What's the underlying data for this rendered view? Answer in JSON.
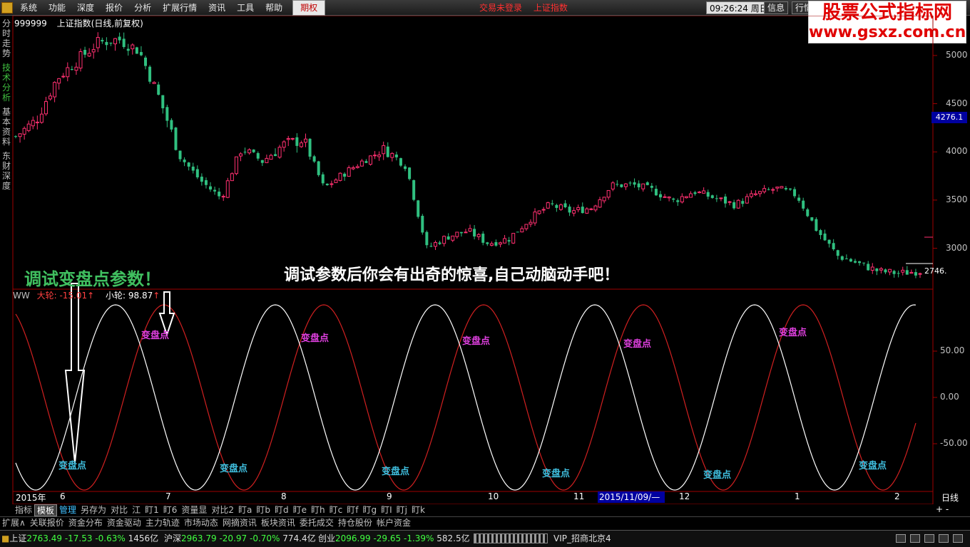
{
  "menu": {
    "items": [
      "系统",
      "功能",
      "深度",
      "报价",
      "分析",
      "扩展行情",
      "资讯",
      "工具",
      "帮助"
    ],
    "active": "期权"
  },
  "status": {
    "trade": "交易未登录",
    "index": "上证指数",
    "time": "09:26:24",
    "weekday": "周日",
    "btn_info": "信息",
    "btn_market": "行情"
  },
  "watermark": {
    "line1": "股票公式指标网",
    "line2": "www.gsxz.com.cn"
  },
  "side_tabs": [
    {
      "label": "分时走势",
      "active": false
    },
    {
      "label": "技术分析",
      "active": true
    },
    {
      "label": "基本资料",
      "active": false
    },
    {
      "label": "东财深度",
      "active": false
    }
  ],
  "price_chart": {
    "code": "999999",
    "title": "上证指数(日线,前复权)",
    "y_ticks": [
      5000,
      4500,
      4000,
      3500,
      3000
    ],
    "y_range": [
      2620,
      5280
    ],
    "current_price": "4276.1",
    "last_price": "2746.",
    "up_color": "#ff3070",
    "down_color": "#30c080"
  },
  "annotations": {
    "left": "调试变盘点参数！",
    "center": "调试参数后你会有出奇的惊喜,自己动脑动手吧！"
  },
  "indicator": {
    "name": "WW",
    "big_label": "大轮:",
    "big_value": "-15.01",
    "small_label": "小轮:",
    "small_value": "98.87",
    "y_ticks": [
      "50.00",
      "0.00",
      "-50.00"
    ],
    "y_range": [
      -100,
      100
    ],
    "big_color": "#d02020",
    "small_color": "#ffffff",
    "turn_label": "变盘点"
  },
  "date_axis": {
    "labels": [
      "2015年",
      "6",
      "7",
      "8",
      "9",
      "10",
      "11",
      "12",
      "1",
      "2"
    ],
    "highlight": "2015/11/09/—",
    "period": "日线"
  },
  "tabs_row1": [
    "指标",
    "模板",
    "管理",
    "另存为",
    "对比",
    "江",
    "盯1",
    "盯6",
    "资量显",
    "对比2",
    "盯a",
    "盯b",
    "盯d",
    "盯e",
    "盯h",
    "盯c",
    "盯f",
    "盯g",
    "盯I",
    "盯j",
    "盯k"
  ],
  "tabs_row1_active": "模板",
  "tabs_row1_hl": "管理",
  "scale_buttons": "+ -",
  "tabs_row2": [
    "扩展∧",
    "关联报价",
    "资金分布",
    "资金驱动",
    "主力轨迹",
    "市场动态",
    "网摘资讯",
    "板块资讯",
    "委托成交",
    "持仓股份",
    "帐户资金"
  ],
  "statusbar": {
    "sh": {
      "name": "上证",
      "price": "2763.49",
      "chg": "-17.53",
      "pct": "-0.63%",
      "amt": "1456亿"
    },
    "hs": {
      "name": "沪深",
      "price": "2963.79",
      "chg": "-20.97",
      "pct": "-0.70%",
      "amt": "774.4亿"
    },
    "cy": {
      "name": "创业",
      "price": "2096.99",
      "chg": "-29.65",
      "pct": "-1.39%",
      "amt": "582.5亿"
    },
    "server": "VIP_招商北京4"
  },
  "chart_data": [
    {
      "type": "candlestick",
      "title": "上证指数(日线,前复权)",
      "ylim": [
        2620,
        5280
      ],
      "y_ticks": [
        3000,
        3500,
        4000,
        4500,
        5000
      ],
      "anchors": [
        4160,
        4330,
        4760,
        4950,
        5130,
        5170,
        5050,
        4550,
        3950,
        3700,
        3520,
        4050,
        3900,
        4070,
        4130,
        3620,
        3780,
        3920,
        4030,
        3850,
        3000,
        3120,
        3180,
        3050,
        3100,
        3300,
        3450,
        3380,
        3420,
        3650,
        3660,
        3600,
        3490,
        3590,
        3520,
        3450,
        3560,
        3620,
        3550,
        3180,
        2920,
        2840,
        2760,
        2740,
        2763
      ]
    },
    {
      "type": "line",
      "series": [
        {
          "name": "大轮",
          "color": "#d02020",
          "amplitude": 100,
          "period_px": 224,
          "phase_px": 230
        },
        {
          "name": "小轮",
          "color": "#ffffff",
          "amplitude": 100,
          "period_px": 224,
          "phase_px": 162
        }
      ],
      "ylim": [
        -100,
        100
      ],
      "y_ticks": [
        50,
        0,
        -50
      ]
    }
  ]
}
